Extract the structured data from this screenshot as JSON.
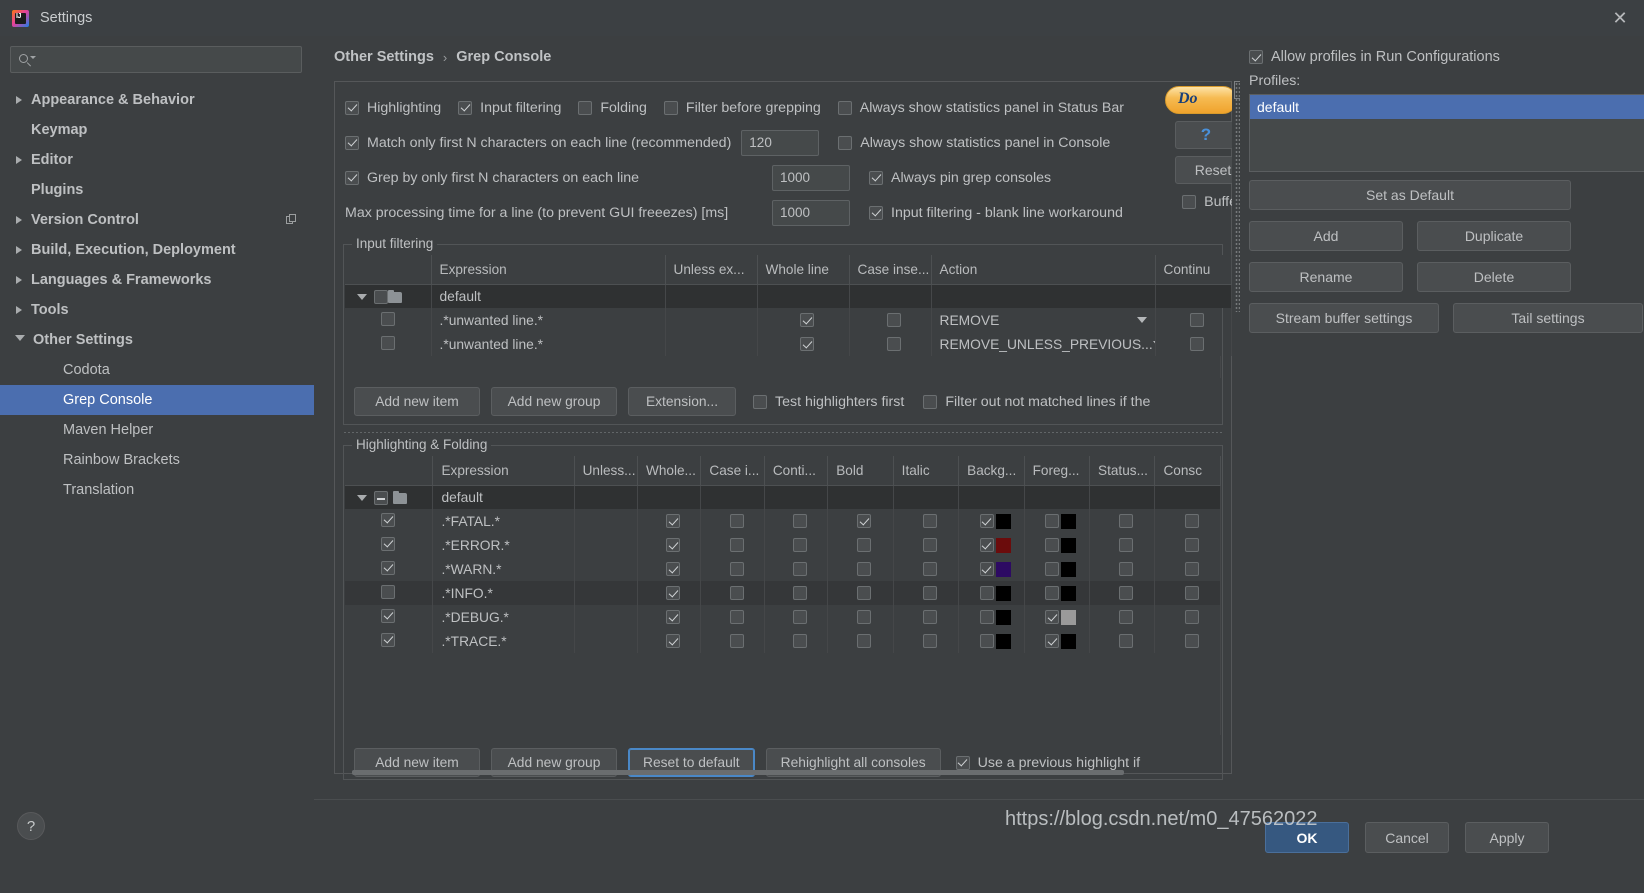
{
  "window": {
    "title": "Settings",
    "close_icon": "✕",
    "logo_text": "IJ"
  },
  "sidebar": {
    "search": {
      "value": "",
      "placeholder": ""
    },
    "items": [
      {
        "label": "Appearance & Behavior",
        "level": 1,
        "arrow": "right",
        "selected": false,
        "extra_icon": ""
      },
      {
        "label": "Keymap",
        "level": 1,
        "arrow": "none",
        "selected": false,
        "extra_icon": ""
      },
      {
        "label": "Editor",
        "level": 1,
        "arrow": "right",
        "selected": false,
        "extra_icon": ""
      },
      {
        "label": "Plugins",
        "level": 1,
        "arrow": "none",
        "selected": false,
        "extra_icon": ""
      },
      {
        "label": "Version Control",
        "level": 1,
        "arrow": "right",
        "selected": false,
        "extra_icon": "copy-icon"
      },
      {
        "label": "Build, Execution, Deployment",
        "level": 1,
        "arrow": "right",
        "selected": false,
        "extra_icon": ""
      },
      {
        "label": "Languages & Frameworks",
        "level": 1,
        "arrow": "right",
        "selected": false,
        "extra_icon": ""
      },
      {
        "label": "Tools",
        "level": 1,
        "arrow": "right",
        "selected": false,
        "extra_icon": ""
      },
      {
        "label": "Other Settings",
        "level": 1,
        "arrow": "down",
        "selected": false,
        "extra_icon": ""
      },
      {
        "label": "Codota",
        "level": 2,
        "arrow": "none",
        "selected": false,
        "extra_icon": ""
      },
      {
        "label": "Grep Console",
        "level": 2,
        "arrow": "none",
        "selected": true,
        "extra_icon": ""
      },
      {
        "label": "Maven Helper",
        "level": 2,
        "arrow": "none",
        "selected": false,
        "extra_icon": ""
      },
      {
        "label": "Rainbow Brackets",
        "level": 2,
        "arrow": "none",
        "selected": false,
        "extra_icon": ""
      },
      {
        "label": "Translation",
        "level": 2,
        "arrow": "none",
        "selected": false,
        "extra_icon": ""
      }
    ],
    "help_label": "?"
  },
  "header": {
    "breadcrumb_parent": "Other Settings",
    "breadcrumb_sep": "›",
    "breadcrumb_current": "Grep Console",
    "reset_link": "Reset"
  },
  "options": {
    "row1": [
      {
        "label": "Highlighting",
        "checked": true
      },
      {
        "label": "Input filtering",
        "checked": true
      },
      {
        "label": "Folding",
        "checked": false
      },
      {
        "label": "Filter before grepping",
        "checked": false
      },
      {
        "label": "Always show statistics panel in Status Bar",
        "checked": false
      }
    ],
    "row2": {
      "left_label": "Match only first N characters on each line (recommended)",
      "left_checked": true,
      "value": "120",
      "right_label": "Always show statistics panel in Console",
      "right_checked": false
    },
    "row3": {
      "left_label": "Grep by only first N characters on each line",
      "left_checked": true,
      "value": "1000",
      "right_label": "Always pin grep consoles",
      "right_checked": true
    },
    "row4": {
      "left_label": "Max processing time for a line (to prevent GUI freeezes) [ms]",
      "value": "1000",
      "right_label": "Input filtering - blank line workaround",
      "right_checked": true
    },
    "donate_label": "Do",
    "help_label": "?",
    "reset_label": "Reset",
    "buffer_label": "Buffe",
    "buffer_checked": false
  },
  "input_filtering": {
    "title": "Input filtering",
    "columns": [
      "",
      "Expression",
      "Unless ex...",
      "Whole line",
      "Case inse...",
      "Action",
      "Continu"
    ],
    "rows": [
      {
        "type": "group",
        "label": "default",
        "enabled": false,
        "unless": "",
        "whole_line": null,
        "case_insensitive": null,
        "action": "",
        "continue": null
      },
      {
        "type": "item",
        "label": ".*unwanted line.*",
        "enabled": false,
        "unless": "",
        "whole_line": true,
        "case_insensitive": false,
        "action": "REMOVE",
        "continue": false
      },
      {
        "type": "item",
        "label": ".*unwanted line.*",
        "enabled": false,
        "unless": "",
        "whole_line": true,
        "case_insensitive": false,
        "action": "REMOVE_UNLESS_PREVIOUS...",
        "continue": false
      }
    ],
    "buttons": [
      "Add new item",
      "Add new group",
      "Extension..."
    ],
    "checkboxes": [
      {
        "label": "Test highlighters first",
        "checked": false
      },
      {
        "label": "Filter out not matched lines if the",
        "checked": false
      }
    ]
  },
  "highlighting": {
    "title": "Highlighting & Folding",
    "columns": [
      "",
      "Expression",
      "Unless...",
      "Whole...",
      "Case i...",
      "Conti...",
      "Bold",
      "Italic",
      "Backg...",
      "Foreg...",
      "Status...",
      "Consc"
    ],
    "rows": [
      {
        "type": "group",
        "label": "default",
        "enabled": null,
        "whole": null,
        "case": null,
        "conti": null,
        "bold": null,
        "italic": null,
        "bg_on": null,
        "bg_color": "",
        "fg_on": null,
        "fg_color": "",
        "status": null,
        "console": null
      },
      {
        "type": "item",
        "label": ".*FATAL.*",
        "enabled": true,
        "whole": true,
        "case": false,
        "conti": false,
        "bold": true,
        "italic": false,
        "bg_on": true,
        "bg_color": "#000000",
        "fg_on": false,
        "fg_color": "#000000",
        "status": false,
        "console": false
      },
      {
        "type": "item",
        "label": ".*ERROR.*",
        "enabled": true,
        "whole": true,
        "case": false,
        "conti": false,
        "bold": false,
        "italic": false,
        "bg_on": true,
        "bg_color": "#6b0c0c",
        "fg_on": false,
        "fg_color": "#000000",
        "status": false,
        "console": false
      },
      {
        "type": "item",
        "label": ".*WARN.*",
        "enabled": true,
        "whole": true,
        "case": false,
        "conti": false,
        "bold": false,
        "italic": false,
        "bg_on": true,
        "bg_color": "#2d0a63",
        "fg_on": false,
        "fg_color": "#000000",
        "status": false,
        "console": false
      },
      {
        "type": "item",
        "label": ".*INFO.*",
        "enabled": false,
        "whole": true,
        "case": false,
        "conti": false,
        "bold": false,
        "italic": false,
        "bg_on": false,
        "bg_color": "#000000",
        "fg_on": false,
        "fg_color": "#000000",
        "status": false,
        "console": false
      },
      {
        "type": "item",
        "label": ".*DEBUG.*",
        "enabled": true,
        "whole": true,
        "case": false,
        "conti": false,
        "bold": false,
        "italic": false,
        "bg_on": false,
        "bg_color": "#000000",
        "fg_on": true,
        "fg_color": "#9a9a9a",
        "status": false,
        "console": false
      },
      {
        "type": "item",
        "label": ".*TRACE.*",
        "enabled": true,
        "whole": true,
        "case": false,
        "conti": false,
        "bold": false,
        "italic": false,
        "bg_on": false,
        "bg_color": "#000000",
        "fg_on": true,
        "fg_color": "#000000",
        "status": false,
        "console": false
      }
    ],
    "buttons": [
      {
        "label": "Add new item",
        "focused": false
      },
      {
        "label": "Add new group",
        "focused": false
      },
      {
        "label": "Reset to default",
        "focused": true
      },
      {
        "label": "Rehighlight all consoles",
        "focused": false
      }
    ],
    "trailing_checkbox": {
      "label": "Use a previous highlight if",
      "checked": true
    }
  },
  "profiles_panel": {
    "allow_label": "Allow profiles in Run Configurations",
    "allow_checked": true,
    "profiles_label": "Profiles:",
    "profiles": [
      {
        "name": "default",
        "selected": true
      }
    ],
    "set_default": "Set as Default",
    "add": "Add",
    "duplicate": "Duplicate",
    "rename": "Rename",
    "delete": "Delete",
    "stream_buffer": "Stream buffer settings",
    "tail_settings": "Tail settings"
  },
  "footer": {
    "ok": "OK",
    "cancel": "Cancel",
    "apply": "Apply",
    "watermark": "https://blog.csdn.net/m0_47562022"
  }
}
